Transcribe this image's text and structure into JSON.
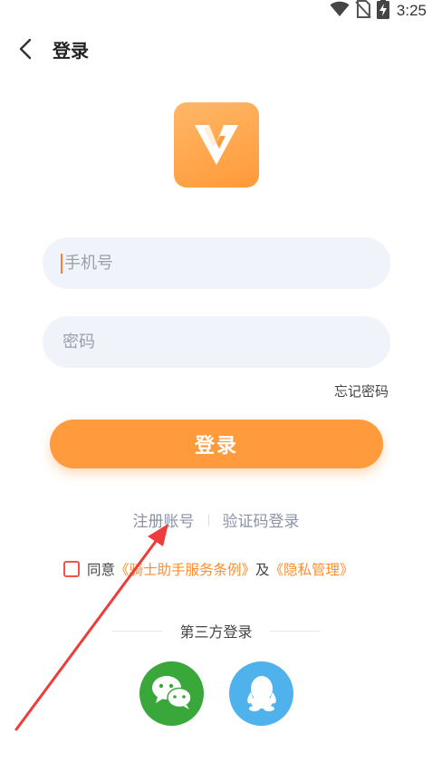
{
  "status_bar": {
    "time": "3:25",
    "icons": [
      "wifi-icon",
      "no-sim-icon",
      "battery-charging-icon"
    ]
  },
  "header": {
    "title": "登录",
    "back_icon": "chevron-left-icon"
  },
  "logo": {
    "icon": "app-logo-v",
    "colors": {
      "start": "#ffb766",
      "end": "#ff9a3a"
    }
  },
  "form": {
    "phone": {
      "placeholder": "手机号",
      "value": ""
    },
    "password": {
      "placeholder": "密码",
      "value": ""
    },
    "forgot_label": "忘记密码",
    "login_label": "登录"
  },
  "links": {
    "register_label": "注册账号",
    "code_login_label": "验证码登录"
  },
  "agreement": {
    "checked": false,
    "prefix": "同意",
    "terms_label": "《骑士助手服务条例》",
    "conjunction": "及",
    "privacy_label": "《隐私管理》"
  },
  "third_party": {
    "label": "第三方登录",
    "providers": [
      {
        "name": "wechat",
        "icon": "wechat-icon",
        "color": "#3aa73b"
      },
      {
        "name": "qq",
        "icon": "qq-icon",
        "color": "#4fb2ec"
      }
    ]
  },
  "colors": {
    "accent": "#ff9a3d",
    "link_orange": "#ff8c2e",
    "input_bg": "#f0f3fa",
    "annotation_red": "#ee3b3b"
  }
}
